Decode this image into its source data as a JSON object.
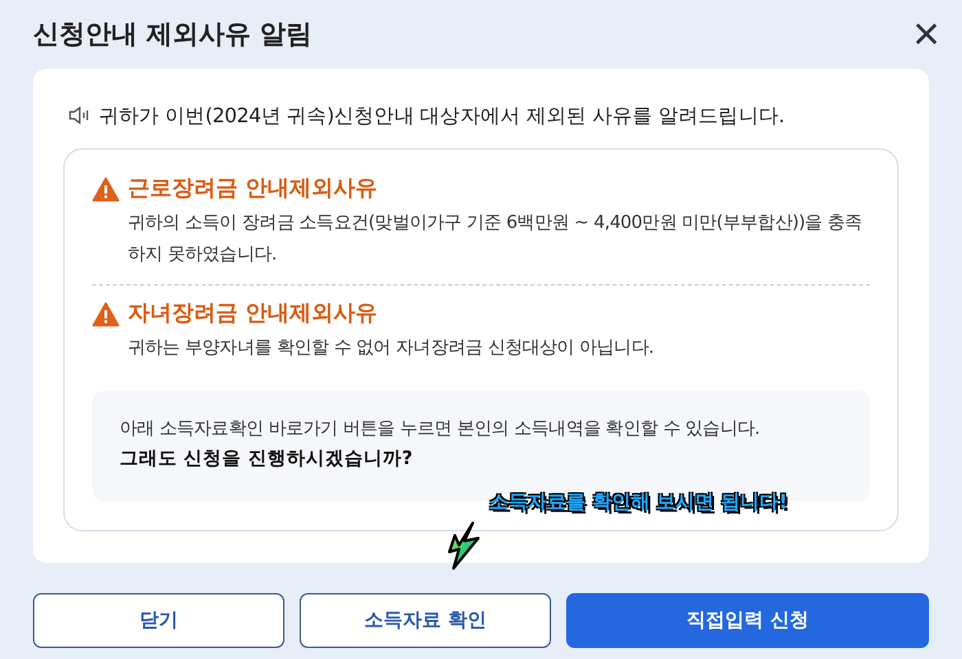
{
  "dialog": {
    "title": "신청안내 제외사유 알림",
    "close": "×"
  },
  "notice": "귀하가 이번(2024년 귀속)신청안내 대상자에서 제외된 사유를 알려드립니다.",
  "reasons": [
    {
      "title": "근로장려금 안내제외사유",
      "text": "귀하의 소득이 장려금 소득요건(맞벌이가구 기준 6백만원 ~ 4,400만원 미만(부부합산))을 충족하지 못하였습니다."
    },
    {
      "title": "자녀장려금 안내제외사유",
      "text": "귀하는 부양자녀를 확인할 수 없어 자녀장려금 신청대상이 아닙니다."
    }
  ],
  "info": {
    "text": "아래 소득자료확인 바로가기 버튼을 누르면 본인의 소득내역을 확인할 수 있습니다.",
    "question": "그래도 신청을 진행하시겠습니까?"
  },
  "annotation": "소득자료를 확인해 보시면 됩니다!",
  "buttons": [
    {
      "label": "닫기",
      "kind": "outline"
    },
    {
      "label": "소득자료 확인",
      "kind": "outline"
    },
    {
      "label": "직접입력 신청",
      "kind": "primary"
    }
  ]
}
